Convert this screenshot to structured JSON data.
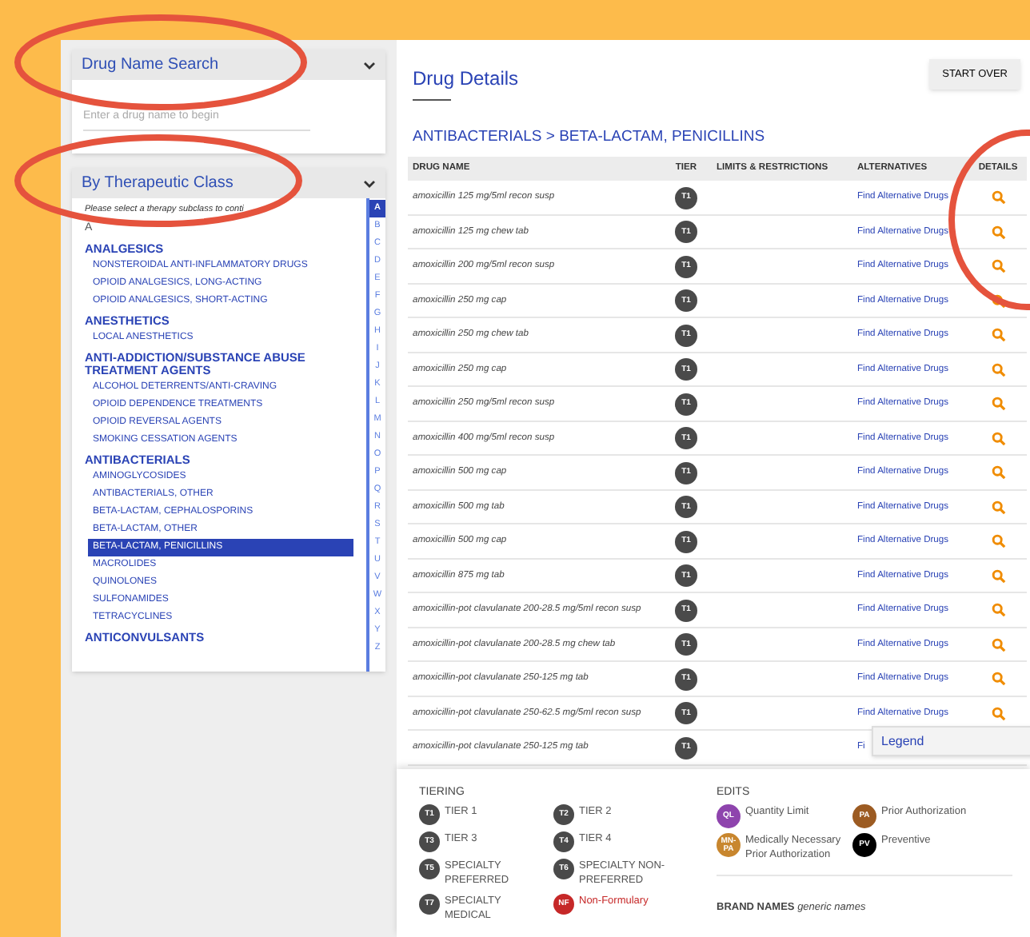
{
  "sidebar": {
    "search": {
      "title": "Drug Name Search",
      "expanded": true,
      "placeholder": "Enter a drug name to begin"
    },
    "therapeutic": {
      "title": "By Therapeutic Class",
      "expanded": true,
      "hint": "Please select a therapy subclass to conti",
      "letter_heading": "A",
      "groups": [
        {
          "name": "ANALGESICS",
          "items": [
            {
              "label": "NONSTEROIDAL ANTI-INFLAMMATORY DRUGS",
              "selected": false
            },
            {
              "label": "OPIOID ANALGESICS, LONG-ACTING",
              "selected": false
            },
            {
              "label": "OPIOID ANALGESICS, SHORT-ACTING",
              "selected": false
            }
          ]
        },
        {
          "name": "ANESTHETICS",
          "items": [
            {
              "label": "LOCAL ANESTHETICS",
              "selected": false
            }
          ]
        },
        {
          "name": "ANTI-ADDICTION/SUBSTANCE ABUSE TREATMENT AGENTS",
          "items": [
            {
              "label": "ALCOHOL DETERRENTS/ANTI-CRAVING",
              "selected": false
            },
            {
              "label": "OPIOID DEPENDENCE TREATMENTS",
              "selected": false
            },
            {
              "label": "OPIOID REVERSAL AGENTS",
              "selected": false
            },
            {
              "label": "SMOKING CESSATION AGENTS",
              "selected": false
            }
          ]
        },
        {
          "name": "ANTIBACTERIALS",
          "items": [
            {
              "label": "AMINOGLYCOSIDES",
              "selected": false
            },
            {
              "label": "ANTIBACTERIALS, OTHER",
              "selected": false
            },
            {
              "label": "BETA-LACTAM, CEPHALOSPORINS",
              "selected": false
            },
            {
              "label": "BETA-LACTAM, OTHER",
              "selected": false
            },
            {
              "label": "BETA-LACTAM, PENICILLINS",
              "selected": true
            },
            {
              "label": "MACROLIDES",
              "selected": false
            },
            {
              "label": "QUINOLONES",
              "selected": false
            },
            {
              "label": "SULFONAMIDES",
              "selected": false
            },
            {
              "label": "TETRACYCLINES",
              "selected": false
            }
          ]
        },
        {
          "name": "ANTICONVULSANTS"
        }
      ],
      "alphabet": [
        {
          "letter": "A",
          "selected": true
        },
        {
          "letter": "B",
          "selected": false
        },
        {
          "letter": "C",
          "selected": false
        },
        {
          "letter": "D",
          "selected": false
        },
        {
          "letter": "E",
          "selected": false
        },
        {
          "letter": "F",
          "selected": false
        },
        {
          "letter": "G",
          "selected": false
        },
        {
          "letter": "H",
          "selected": false
        },
        {
          "letter": "I",
          "selected": false
        },
        {
          "letter": "J",
          "selected": false
        },
        {
          "letter": "K",
          "selected": false
        },
        {
          "letter": "L",
          "selected": false
        },
        {
          "letter": "M",
          "selected": false
        },
        {
          "letter": "N",
          "selected": false
        },
        {
          "letter": "O",
          "selected": false
        },
        {
          "letter": "P",
          "selected": false
        },
        {
          "letter": "Q",
          "selected": false
        },
        {
          "letter": "R",
          "selected": false
        },
        {
          "letter": "S",
          "selected": false
        },
        {
          "letter": "T",
          "selected": false
        },
        {
          "letter": "U",
          "selected": false
        },
        {
          "letter": "V",
          "selected": false
        },
        {
          "letter": "W",
          "selected": false
        },
        {
          "letter": "X",
          "selected": false
        },
        {
          "letter": "Y",
          "selected": false
        },
        {
          "letter": "Z",
          "selected": false
        }
      ]
    }
  },
  "main": {
    "title": "Drug Details",
    "start_over": "START OVER",
    "breadcrumb": "ANTIBACTERIALS > BETA-LACTAM, PENICILLINS",
    "table": {
      "columns": [
        "DRUG NAME",
        "TIER",
        "LIMITS & RESTRICTIONS",
        "ALTERNATIVES",
        "DETAILS"
      ],
      "rows": [
        {
          "name": "amoxicillin 125 mg/5ml recon susp",
          "tier": "T1",
          "alternatives": "Find Alternative Drugs"
        },
        {
          "name": "amoxicillin 125 mg chew tab",
          "tier": "T1",
          "alternatives": "Find Alternative Drugs"
        },
        {
          "name": "amoxicillin 200 mg/5ml recon susp",
          "tier": "T1",
          "alternatives": "Find Alternative Drugs"
        },
        {
          "name": "amoxicillin 250 mg cap",
          "tier": "T1",
          "alternatives": "Find Alternative Drugs"
        },
        {
          "name": "amoxicillin 250 mg chew tab",
          "tier": "T1",
          "alternatives": "Find Alternative Drugs"
        },
        {
          "name": "amoxicillin 250 mg cap",
          "tier": "T1",
          "alternatives": "Find Alternative Drugs"
        },
        {
          "name": "amoxicillin 250 mg/5ml recon susp",
          "tier": "T1",
          "alternatives": "Find Alternative Drugs"
        },
        {
          "name": "amoxicillin 400 mg/5ml recon susp",
          "tier": "T1",
          "alternatives": "Find Alternative Drugs"
        },
        {
          "name": "amoxicillin 500 mg cap",
          "tier": "T1",
          "alternatives": "Find Alternative Drugs"
        },
        {
          "name": "amoxicillin 500 mg tab",
          "tier": "T1",
          "alternatives": "Find Alternative Drugs"
        },
        {
          "name": "amoxicillin 500 mg cap",
          "tier": "T1",
          "alternatives": "Find Alternative Drugs"
        },
        {
          "name": "amoxicillin 875 mg tab",
          "tier": "T1",
          "alternatives": "Find Alternative Drugs"
        },
        {
          "name": "amoxicillin-pot clavulanate 200-28.5 mg/5ml recon susp",
          "tier": "T1",
          "alternatives": "Find Alternative Drugs"
        },
        {
          "name": "amoxicillin-pot clavulanate 200-28.5 mg chew tab",
          "tier": "T1",
          "alternatives": "Find Alternative Drugs"
        },
        {
          "name": "amoxicillin-pot clavulanate 250-125 mg tab",
          "tier": "T1",
          "alternatives": "Find Alternative Drugs"
        },
        {
          "name": "amoxicillin-pot clavulanate 250-62.5 mg/5ml recon susp",
          "tier": "T1",
          "alternatives": "Find Alternative Drugs"
        },
        {
          "name": "amoxicillin-pot clavulanate 250-125 mg tab",
          "tier": "T1",
          "alternatives": "Fi"
        }
      ]
    },
    "legend_tab": {
      "label": "Legend"
    }
  },
  "legend": {
    "tiering_title": "TIERING",
    "tiers": [
      {
        "badge": "T1",
        "label": "TIER 1",
        "color": "#4a4a4a",
        "kind": "tier"
      },
      {
        "badge": "T2",
        "label": "TIER 2",
        "color": "#4a4a4a",
        "kind": "tier"
      },
      {
        "badge": "T3",
        "label": "TIER 3",
        "color": "#4a4a4a",
        "kind": "tier"
      },
      {
        "badge": "T4",
        "label": "TIER 4",
        "color": "#4a4a4a",
        "kind": "tier"
      },
      {
        "badge": "T5",
        "label": "SPECIALTY PREFERRED",
        "color": "#4a4a4a",
        "kind": "tier"
      },
      {
        "badge": "T6",
        "label": "SPECIALTY NON-PREFERRED",
        "color": "#4a4a4a",
        "kind": "tier"
      },
      {
        "badge": "T7",
        "label": "SPECIALTY MEDICAL",
        "color": "#4a4a4a",
        "kind": "tier"
      },
      {
        "badge": "NF",
        "label": "Non-Formulary",
        "color": "#c62828",
        "kind": "nonformulary"
      }
    ],
    "edits_title": "EDITS",
    "edits": [
      {
        "badge": "QL",
        "label": "Quantity Limit",
        "color": "#8e44ad"
      },
      {
        "badge": "PA",
        "label": "Prior Authorization",
        "color": "#9c5b22"
      },
      {
        "badge": "MN-PA",
        "label": "Medically Necessary Prior Authorization",
        "color": "#c8862e"
      },
      {
        "badge": "PV",
        "label": "Preventive",
        "color": "#000000"
      }
    ],
    "brand_names": "**BRAND NAMES** *generic names*"
  }
}
